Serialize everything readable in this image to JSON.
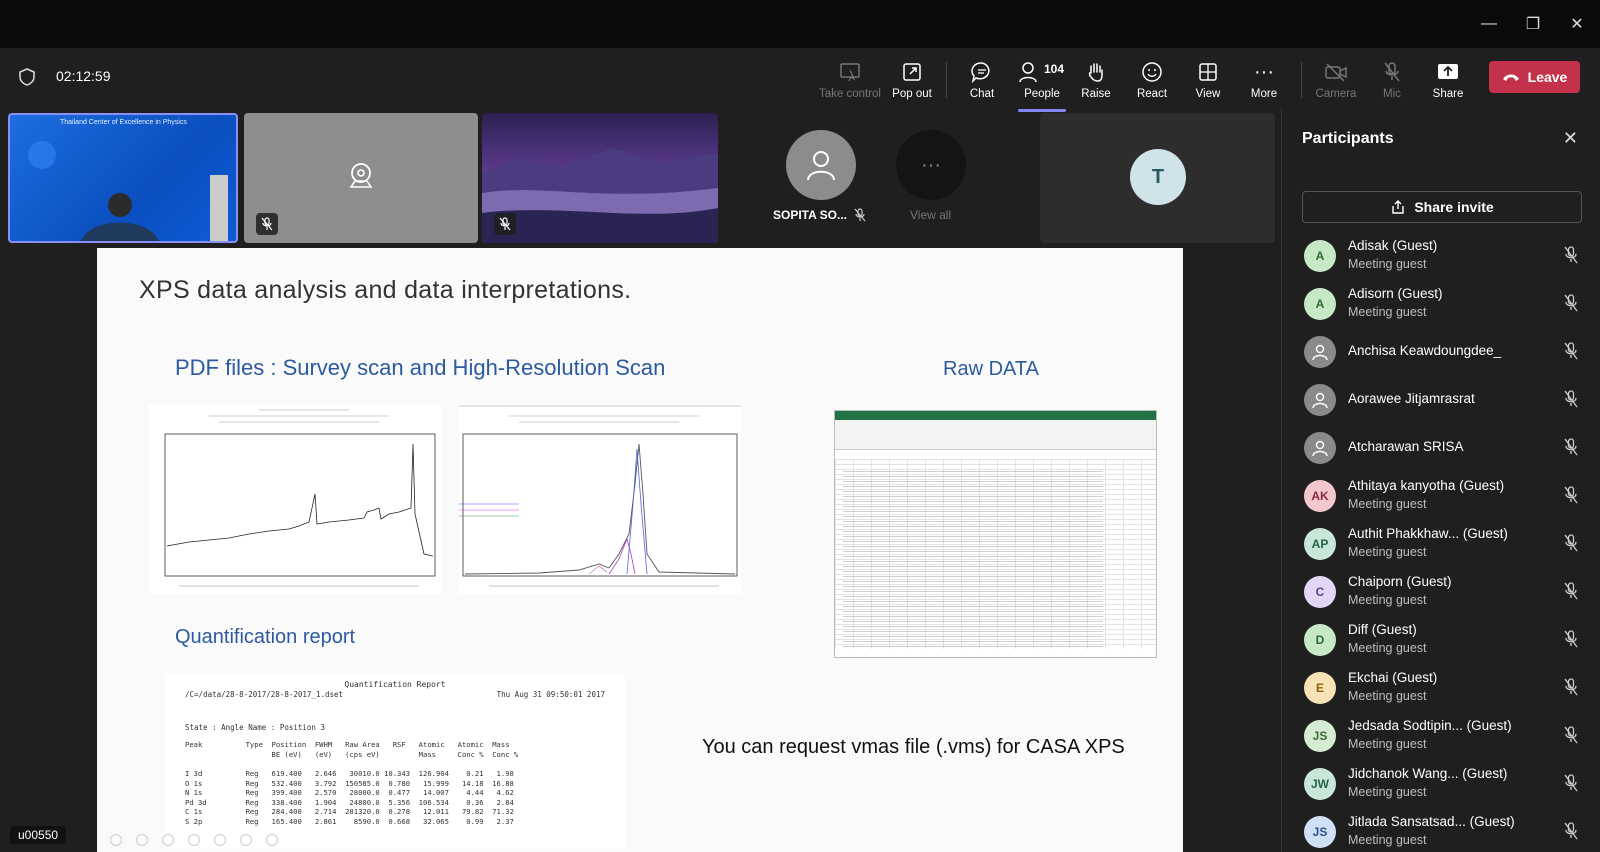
{
  "window": {
    "minimize": "—",
    "restore": "❐",
    "close": "✕"
  },
  "meeting": {
    "timer": "02:12:59"
  },
  "toolbar": {
    "take_control": "Take control",
    "pop_out": "Pop out",
    "chat": "Chat",
    "people": "People",
    "people_count": "104",
    "raise": "Raise",
    "react": "React",
    "view": "View",
    "more": "More",
    "camera": "Camera",
    "mic": "Mic",
    "share": "Share",
    "leave": "Leave"
  },
  "tiles": {
    "banner_text": "Thailand Center of Excellence in Physics",
    "sopita_name": "SOPITA SO...",
    "view_all": "View all",
    "t_initial": "T"
  },
  "slide": {
    "title": "XPS data analysis and data interpretations.",
    "pdf_heading": "PDF files : Survey scan and High-Resolution Scan",
    "raw_heading": "Raw DATA",
    "quant_heading": "Quantification  report",
    "vmas_note": "You can request vmas file (.vms) for CASA XPS",
    "report_title": "Quantification Report",
    "report_path": "/C=/data/28-8-2017/28-8-2017_1.dset",
    "report_date": "Thu Aug 31 09:50:01 2017",
    "report_state": "State : Angle  Name : Position 3",
    "report_header": "Peak          Type  Position  FWHM   Raw Area   RSF   Atomic   Atomic  Mass\n                    BE (eV)   (eV)   (cps eV)         Mass     Conc %  Conc %",
    "report_rows": "I 3d          Reg   619.400   2.646   30010.0 10.343  126.904    0.21   1.98\nO 1s          Reg   532.400   3.792  150585.0  0.780   15.999   14.18  16.88\nN 1s          Reg   399.400   2.570   28000.0  0.477   14.007    4.44   4.62\nPd 3d         Reg   338.400   1.904   24800.0  5.356  106.534    0.36   2.84\nC 1s          Reg   284.400   2.714  281320.0  0.278   12.011   79.82  71.32\nS 2p          Reg   165.400   2.861    8590.0  0.668   32.065    0.99   2.37"
  },
  "participants": {
    "title": "Participants",
    "share_invite": "Share invite",
    "list": [
      {
        "initials": "A",
        "name": "Adisak (Guest)",
        "sub": "Meeting guest",
        "color": "#c7e7c5",
        "fg": "#2e6b2a"
      },
      {
        "initials": "A",
        "name": "Adisorn (Guest)",
        "sub": "Meeting guest",
        "color": "#c7e7c5",
        "fg": "#2e6b2a"
      },
      {
        "initials": "",
        "name": "Anchisa Keawdoungdee_",
        "sub": "",
        "color": "#8a8a8a",
        "fg": "#fff"
      },
      {
        "initials": "",
        "name": "Aorawee Jitjamrasrat",
        "sub": "",
        "color": "#8a8a8a",
        "fg": "#fff"
      },
      {
        "initials": "",
        "name": "Atcharawan SRISA",
        "sub": "",
        "color": "#8a8a8a",
        "fg": "#fff"
      },
      {
        "initials": "AK",
        "name": "Athitaya kanyotha (Guest)",
        "sub": "Meeting guest",
        "color": "#f4c7cf",
        "fg": "#8a2a3c"
      },
      {
        "initials": "AP",
        "name": "Authit Phakkhaw... (Guest)",
        "sub": "Meeting guest",
        "color": "#c9e6d9",
        "fg": "#24614a"
      },
      {
        "initials": "C",
        "name": "Chaiporn (Guest)",
        "sub": "Meeting guest",
        "color": "#e2d6f5",
        "fg": "#5a3f8f"
      },
      {
        "initials": "D",
        "name": "Diff (Guest)",
        "sub": "Meeting guest",
        "color": "#c7e7c5",
        "fg": "#2e6b2a"
      },
      {
        "initials": "E",
        "name": "Ekchai (Guest)",
        "sub": "Meeting guest",
        "color": "#f7e3b5",
        "fg": "#8a6014"
      },
      {
        "initials": "JS",
        "name": "Jedsada Sodtipin... (Guest)",
        "sub": "Meeting guest",
        "color": "#d6ecd2",
        "fg": "#3d6b35"
      },
      {
        "initials": "JW",
        "name": "Jidchanok Wang... (Guest)",
        "sub": "Meeting guest",
        "color": "#c9e6d9",
        "fg": "#24614a"
      },
      {
        "initials": "JS",
        "name": "Jitlada Sansatsad... (Guest)",
        "sub": "Meeting guest",
        "color": "#cfe0f5",
        "fg": "#2e5288"
      }
    ]
  },
  "user_tag": "u00550"
}
